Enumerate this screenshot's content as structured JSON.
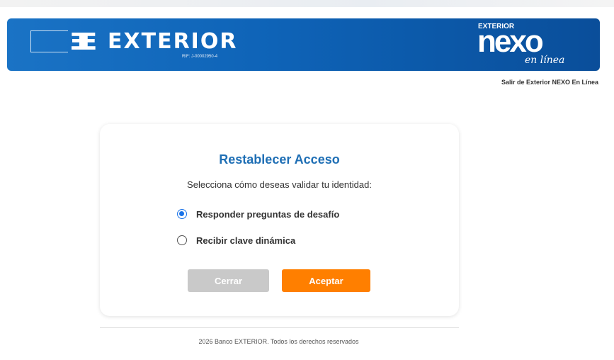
{
  "header": {
    "bank_mark": "ƎE",
    "bank_name": "EXTERIOR",
    "rif": "RIF: J-00002950-4",
    "nexo_top": "EXTERIOR",
    "nexo_word": "nexo",
    "nexo_sub": "en línea",
    "exit_link": "Salir de Exterior NEXO En Línea"
  },
  "dialog": {
    "title": "Restablecer Acceso",
    "subtitle": "Selecciona cómo deseas validar tu identidad:",
    "options": [
      {
        "label": "Responder preguntas de desafío",
        "selected": true
      },
      {
        "label": "Recibir clave dinámica",
        "selected": false
      }
    ],
    "close_label": "Cerrar",
    "accept_label": "Aceptar"
  },
  "footer": {
    "text": "2026 Banco EXTERIOR. Todos los derechos reservados"
  },
  "colors": {
    "banner_blue": "#0e63b7",
    "title_blue": "#1f6fb5",
    "accept_orange": "#ff7f00",
    "close_gray": "#c9c9c9",
    "radio_blue": "#1a73e8"
  }
}
